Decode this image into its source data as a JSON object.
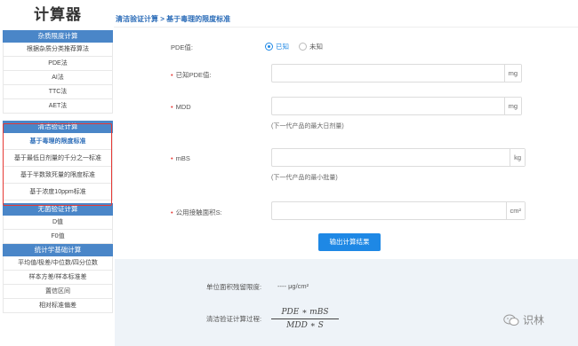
{
  "app": {
    "title": "计算器"
  },
  "breadcrumb": "清洁验证计算 > 基于毒理的限度标准",
  "sidebar": {
    "groups": [
      {
        "header": "杂质限度计算",
        "items": [
          "根据杂质分类推荐算法",
          "PDE法",
          "AI法",
          "TTC法",
          "AET法"
        ]
      },
      {
        "header": "清洁验证计算",
        "items": [
          "基于毒理的限度标准",
          "基于最低日剂量的千分之一标准",
          "基于半数致死量的限度标准",
          "基于浓度10ppm标准"
        ]
      },
      {
        "header": "无菌验证计算",
        "items": [
          "D值",
          "F0值"
        ]
      },
      {
        "header": "统计学基础计算",
        "items": [
          "平均值/极差/中位数/四分位数",
          "样本方差/样本标准差",
          "置信区间",
          "相对标准偏差"
        ]
      }
    ]
  },
  "form": {
    "pde": {
      "label": "PDE值:",
      "options": [
        "已知",
        "未知"
      ]
    },
    "known_pde": {
      "label": "已知PDE值:",
      "unit": "mg"
    },
    "mdd": {
      "label": "MDD",
      "unit": "mg",
      "hint": "(下一代产品的最大日剂量)"
    },
    "mbs": {
      "label": "mBS",
      "unit": "kg",
      "hint": "(下一代产品的最小批量)"
    },
    "area": {
      "label": "公用接触面积S:",
      "unit": "cm²"
    },
    "submit": "输出计算结果"
  },
  "result": {
    "limit_label": "单位面积残留限度:",
    "limit_value": "---- μg/cm²",
    "process_label": "清洁验证计算过程:",
    "formula_num": "PDE ∗ mBS",
    "formula_den": "MDD ∗ S"
  },
  "watermark": "识林"
}
